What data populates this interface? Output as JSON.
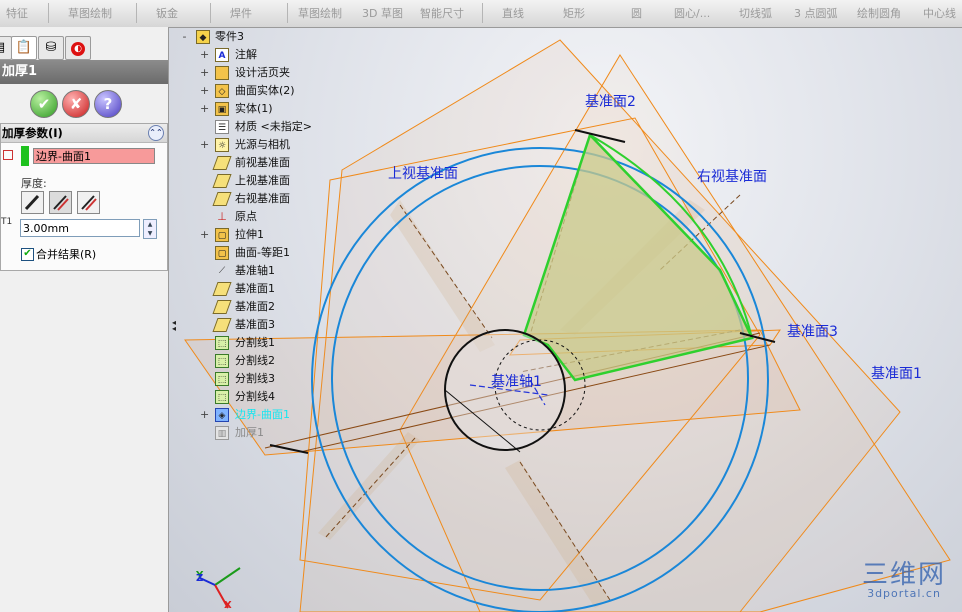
{
  "toolbar": {
    "items": [
      "特征",
      "草图绘制",
      "钣金",
      "焊件",
      "草图绘制",
      "3D 草图",
      "智能尺寸",
      "直线",
      "矩形",
      "圆",
      "圆心/...",
      "切线弧",
      "3 点圆弧",
      "绘制圆角",
      "中心线"
    ]
  },
  "property_manager": {
    "title": "加厚1",
    "ok_symbol": "✔",
    "cancel_symbol": "✘",
    "help_symbol": "?",
    "group_title": "加厚参数(I)",
    "face_value": "边界-曲面1",
    "thickness_label": "厚度:",
    "thickness_value": "3.00mm",
    "merge_label": "合并结果(R)",
    "merge_checked": true,
    "face_color": "#f79a9a",
    "selection_color": "#1ec21e"
  },
  "feature_tree": {
    "items": [
      {
        "label": "零件3",
        "icon": "part-icon",
        "expand": "-"
      },
      {
        "label": "注解",
        "icon": "annotation-icon",
        "expand": "+"
      },
      {
        "label": "设计活页夹",
        "icon": "design-binder-icon",
        "expand": "+"
      },
      {
        "label": "曲面实体(2)",
        "icon": "surface-bodies-icon",
        "expand": "+"
      },
      {
        "label": "实体(1)",
        "icon": "solid-bodies-icon",
        "expand": "+"
      },
      {
        "label": "材质 <未指定>",
        "icon": "material-icon",
        "expand": ""
      },
      {
        "label": "光源与相机",
        "icon": "lights-cameras-icon",
        "expand": "+"
      },
      {
        "label": "前视基准面",
        "icon": "plane-icon",
        "expand": ""
      },
      {
        "label": "上视基准面",
        "icon": "plane-icon",
        "expand": ""
      },
      {
        "label": "右视基准面",
        "icon": "plane-icon",
        "expand": ""
      },
      {
        "label": "原点",
        "icon": "origin-icon",
        "expand": ""
      },
      {
        "label": "拉伸1",
        "icon": "extrude-icon",
        "expand": "+"
      },
      {
        "label": "曲面-等距1",
        "icon": "offset-surface-icon",
        "expand": ""
      },
      {
        "label": "基准轴1",
        "icon": "axis-icon",
        "expand": ""
      },
      {
        "label": "基准面1",
        "icon": "plane-icon",
        "expand": ""
      },
      {
        "label": "基准面2",
        "icon": "plane-icon",
        "expand": ""
      },
      {
        "label": "基准面3",
        "icon": "plane-icon",
        "expand": ""
      },
      {
        "label": "分割线1",
        "icon": "split-line-icon",
        "expand": ""
      },
      {
        "label": "分割线2",
        "icon": "split-line-icon",
        "expand": ""
      },
      {
        "label": "分割线3",
        "icon": "split-line-icon",
        "expand": ""
      },
      {
        "label": "分割线4",
        "icon": "split-line-icon",
        "expand": ""
      },
      {
        "label": "边界-曲面1",
        "icon": "boundary-surface-icon",
        "expand": "+",
        "state": "selected"
      },
      {
        "label": "加厚1",
        "icon": "thicken-icon",
        "expand": "",
        "state": "suppressed"
      }
    ]
  },
  "viewport": {
    "labels": {
      "plane2": "基准面2",
      "top_plane": "上视基准面",
      "right_plane": "右视基准面",
      "plane3": "基准面3",
      "plane1": "基准面1",
      "axis1": "基准轴1"
    },
    "triad": {
      "x": "X",
      "y": "Y",
      "z": "Z"
    },
    "plane_color": "#f08a1a",
    "edge_color": "#1a87d8",
    "surface_color": "#c9c98a",
    "label_color": "#1a2bd6"
  },
  "watermark": {
    "big": "三维网",
    "small": "3dportal.cn"
  }
}
